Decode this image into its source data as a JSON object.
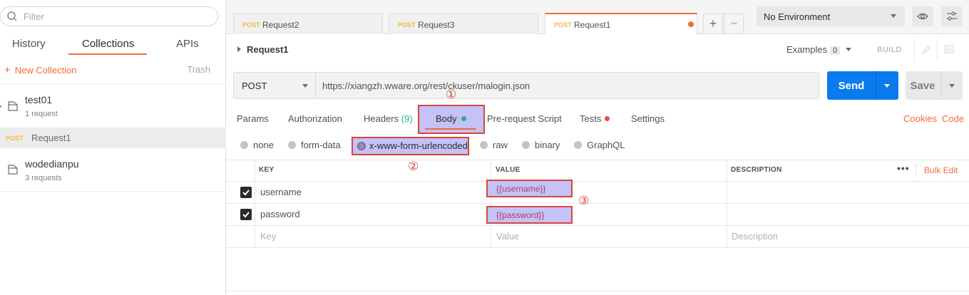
{
  "sidebar": {
    "filter_placeholder": "Filter",
    "tabs": [
      "History",
      "Collections",
      "APIs"
    ],
    "new_collection": "New Collection",
    "trash": "Trash",
    "collections": [
      {
        "name": "test01",
        "sub": "1 request"
      },
      {
        "name": "wodedianpu",
        "sub": "3 requests"
      }
    ],
    "request_item": {
      "method": "POST",
      "name": "Request1"
    }
  },
  "tabs": [
    {
      "method": "POST",
      "name": "Request2"
    },
    {
      "method": "POST",
      "name": "Request3"
    },
    {
      "method": "POST",
      "name": "Request1"
    }
  ],
  "tab_buttons": {
    "add": "+",
    "more": "◦◦◦"
  },
  "environment": {
    "selected": "No Environment"
  },
  "request": {
    "name": "Request1",
    "examples_label": "Examples",
    "examples_count": "0",
    "build_label": "BUILD",
    "method": "POST",
    "url": "https://xiangzh.wware.org/rest/ckuser/malogin.json",
    "send": "Send",
    "save": "Save"
  },
  "subtabs": {
    "params": "Params",
    "authorization": "Authorization",
    "headers": "Headers",
    "headers_count": "(9)",
    "body": "Body",
    "prerequest": "Pre-request Script",
    "tests": "Tests",
    "settings": "Settings",
    "cookies": "Cookies",
    "code": "Code"
  },
  "body_types": {
    "none": "none",
    "form_data": "form-data",
    "urlencoded": "x-www-form-urlencoded",
    "raw": "raw",
    "binary": "binary",
    "graphql": "GraphQL"
  },
  "annotations": {
    "one": "①",
    "two": "②",
    "three": "③"
  },
  "table": {
    "headers": {
      "key": "KEY",
      "value": "VALUE",
      "description": "DESCRIPTION"
    },
    "more": "•••",
    "bulk_edit": "Bulk Edit",
    "rows": [
      {
        "key": "username",
        "value": "{{username}}"
      },
      {
        "key": "password",
        "value": "{{password}}"
      }
    ],
    "placeholders": {
      "key": "Key",
      "value": "Value",
      "description": "Description"
    }
  },
  "colors": {
    "accent": "#f26b3a",
    "send": "#097bed",
    "highlight": "#c4c2f6",
    "annotation": "#d9453e"
  }
}
